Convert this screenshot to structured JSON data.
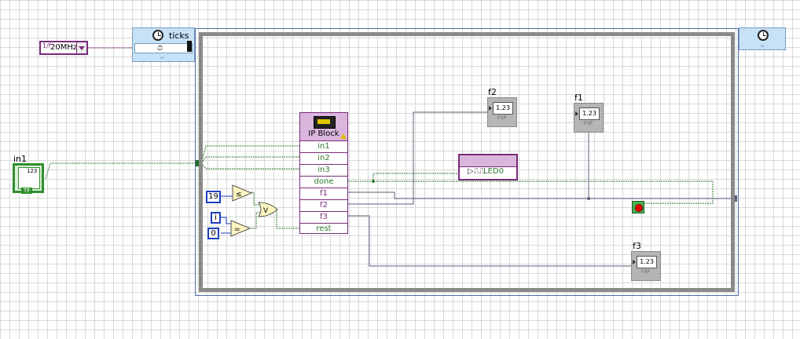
{
  "clock": {
    "value": "20MHz",
    "glyph": "1/f"
  },
  "timed_loop": {
    "input_label": "ticks"
  },
  "controls": {
    "in1": {
      "label": "in1",
      "display": "123",
      "type_tag": "TF"
    }
  },
  "ip_block": {
    "title": "IP Block",
    "inputs": [
      "in1",
      "in2",
      "in3"
    ],
    "outputs": [
      "done",
      "f1",
      "f2",
      "f3"
    ],
    "last_input": "rest"
  },
  "indicators": {
    "f1": {
      "label": "f1",
      "display": "1.23",
      "sub": "FXP"
    },
    "f2": {
      "label": "f2",
      "display": "1.23",
      "sub": "FXP"
    },
    "f3": {
      "label": "f3",
      "display": "1.23",
      "sub": "FXP"
    }
  },
  "led": {
    "label": "LED0"
  },
  "constants": {
    "c19": "19",
    "ci": "i",
    "c0": "0"
  },
  "colors": {
    "wire_green": "#2f7a2f",
    "wire_purple": "#7a2a7a",
    "wire_gray": "#5d5d7a",
    "loop_blue": "#c7e1f6"
  }
}
